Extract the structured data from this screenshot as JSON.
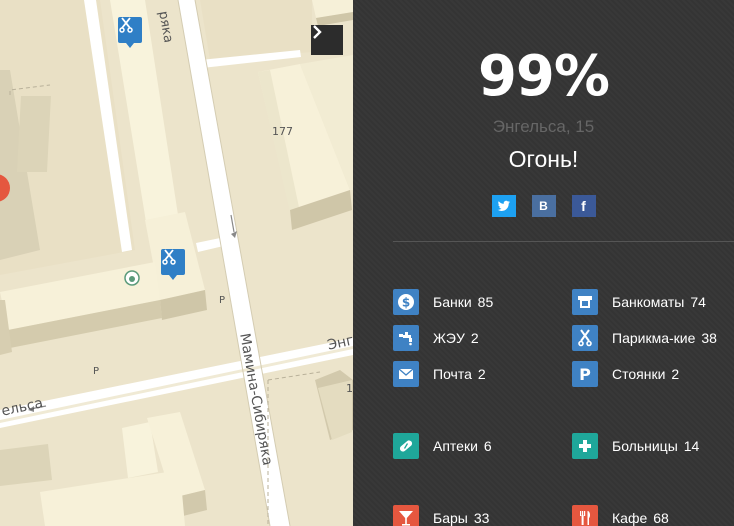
{
  "map": {
    "labels": {
      "street_top": "ряка",
      "street_mamina": "Мамина-Сибиряка",
      "street_engelsa_left": "ельса",
      "street_engelsa_right": "Энгел",
      "house_177": "177",
      "parking_1": "P",
      "parking_2": "P",
      "edge_digit": "1"
    },
    "next_button_icon": "chevron-right-icon",
    "markers": [
      {
        "icon": "scissors-icon"
      },
      {
        "icon": "scissors-icon"
      }
    ]
  },
  "panel": {
    "score": "99%",
    "address": "Энгельса, 15",
    "verdict": "Огонь!",
    "social": [
      {
        "name": "twitter",
        "icon": "twitter-icon",
        "color": "#1da1f2"
      },
      {
        "name": "vk",
        "label": "B",
        "color": "#4a6fa0"
      },
      {
        "name": "facebook",
        "label": "f",
        "color": "#3b5998"
      }
    ],
    "poi": [
      {
        "label": "Банки",
        "count": "85",
        "icon": "dollar-icon",
        "color": "#3f82c4"
      },
      {
        "label": "Банкоматы",
        "count": "74",
        "icon": "atm-icon",
        "color": "#3f82c4"
      },
      {
        "label": "ЖЭУ",
        "count": "2",
        "icon": "faucet-icon",
        "color": "#3f82c4"
      },
      {
        "label": "Парикма-кие",
        "count": "38",
        "icon": "scissors-icon",
        "color": "#3f82c4"
      },
      {
        "label": "Почта",
        "count": "2",
        "icon": "envelope-icon",
        "color": "#3f82c4"
      },
      {
        "label": "Стоянки",
        "count": "2",
        "icon": "parking-icon",
        "color": "#3f82c4"
      },
      {
        "label": "Аптеки",
        "count": "6",
        "icon": "pill-icon",
        "color": "#1fa79a"
      },
      {
        "label": "Больницы",
        "count": "14",
        "icon": "cross-icon",
        "color": "#1fa79a"
      },
      {
        "label": "Бары",
        "count": "33",
        "icon": "cocktail-icon",
        "color": "#e5573f"
      },
      {
        "label": "Кафе",
        "count": "68",
        "icon": "fork-knife-icon",
        "color": "#e5573f"
      }
    ]
  }
}
